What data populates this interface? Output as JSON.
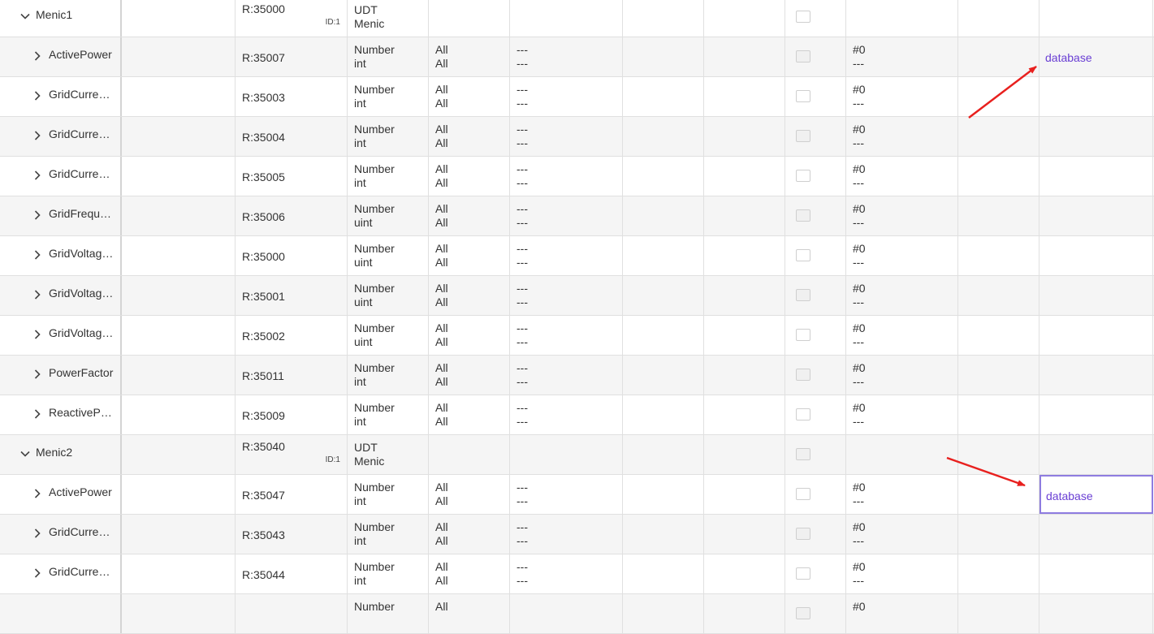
{
  "colors": {
    "link": "#6a3fd4",
    "annotation_arrow": "#e8201e",
    "selection_border": "#8e7ce0"
  },
  "icons": {
    "collapse": "chevron-down-icon",
    "expand": "chevron-right-icon"
  },
  "rows": [
    {
      "kind": "group",
      "expanded": true,
      "name": "Menic1",
      "address": "R:35000",
      "id_label": "ID:1",
      "type_line1": "UDT",
      "type_line2": "Menic",
      "col5_line1": "",
      "col5_line2": "",
      "col6_line1": "",
      "col6_line2": "",
      "col10_line1": "",
      "col10_line2": "",
      "link": ""
    },
    {
      "kind": "child",
      "expanded": false,
      "name": "ActivePower",
      "address": "R:35007",
      "id_label": "",
      "type_line1": "Number",
      "type_line2": "int",
      "col5_line1": "All",
      "col5_line2": "All",
      "col6_line1": "---",
      "col6_line2": "---",
      "col10_line1": "#0",
      "col10_line2": "---",
      "link": "database"
    },
    {
      "kind": "child",
      "expanded": false,
      "name": "GridCurrentA",
      "address": "R:35003",
      "id_label": "",
      "type_line1": "Number",
      "type_line2": "int",
      "col5_line1": "All",
      "col5_line2": "All",
      "col6_line1": "---",
      "col6_line2": "---",
      "col10_line1": "#0",
      "col10_line2": "---",
      "link": ""
    },
    {
      "kind": "child",
      "expanded": false,
      "name": "GridCurrentB",
      "address": "R:35004",
      "id_label": "",
      "type_line1": "Number",
      "type_line2": "int",
      "col5_line1": "All",
      "col5_line2": "All",
      "col6_line1": "---",
      "col6_line2": "---",
      "col10_line1": "#0",
      "col10_line2": "---",
      "link": ""
    },
    {
      "kind": "child",
      "expanded": false,
      "name": "GridCurrentC",
      "address": "R:35005",
      "id_label": "",
      "type_line1": "Number",
      "type_line2": "int",
      "col5_line1": "All",
      "col5_line2": "All",
      "col6_line1": "---",
      "col6_line2": "---",
      "col10_line1": "#0",
      "col10_line2": "---",
      "link": ""
    },
    {
      "kind": "child",
      "expanded": false,
      "name": "GridFreque…",
      "address": "R:35006",
      "id_label": "",
      "type_line1": "Number",
      "type_line2": "uint",
      "col5_line1": "All",
      "col5_line2": "All",
      "col6_line1": "---",
      "col6_line2": "---",
      "col10_line1": "#0",
      "col10_line2": "---",
      "link": ""
    },
    {
      "kind": "child",
      "expanded": false,
      "name": "GridVoltag…",
      "address": "R:35000",
      "id_label": "",
      "type_line1": "Number",
      "type_line2": "uint",
      "col5_line1": "All",
      "col5_line2": "All",
      "col6_line1": "---",
      "col6_line2": "---",
      "col10_line1": "#0",
      "col10_line2": "---",
      "link": ""
    },
    {
      "kind": "child",
      "expanded": false,
      "name": "GridVoltag…",
      "address": "R:35001",
      "id_label": "",
      "type_line1": "Number",
      "type_line2": "uint",
      "col5_line1": "All",
      "col5_line2": "All",
      "col6_line1": "---",
      "col6_line2": "---",
      "col10_line1": "#0",
      "col10_line2": "---",
      "link": ""
    },
    {
      "kind": "child",
      "expanded": false,
      "name": "GridVoltag…",
      "address": "R:35002",
      "id_label": "",
      "type_line1": "Number",
      "type_line2": "uint",
      "col5_line1": "All",
      "col5_line2": "All",
      "col6_line1": "---",
      "col6_line2": "---",
      "col10_line1": "#0",
      "col10_line2": "---",
      "link": ""
    },
    {
      "kind": "child",
      "expanded": false,
      "name": "PowerFactor",
      "address": "R:35011",
      "id_label": "",
      "type_line1": "Number",
      "type_line2": "int",
      "col5_line1": "All",
      "col5_line2": "All",
      "col6_line1": "---",
      "col6_line2": "---",
      "col10_line1": "#0",
      "col10_line2": "---",
      "link": ""
    },
    {
      "kind": "child",
      "expanded": false,
      "name": "ReactivePo…",
      "address": "R:35009",
      "id_label": "",
      "type_line1": "Number",
      "type_line2": "int",
      "col5_line1": "All",
      "col5_line2": "All",
      "col6_line1": "---",
      "col6_line2": "---",
      "col10_line1": "#0",
      "col10_line2": "---",
      "link": ""
    },
    {
      "kind": "group",
      "expanded": true,
      "name": "Menic2",
      "address": "R:35040",
      "id_label": "ID:1",
      "type_line1": "UDT",
      "type_line2": "Menic",
      "col5_line1": "",
      "col5_line2": "",
      "col6_line1": "",
      "col6_line2": "",
      "col10_line1": "",
      "col10_line2": "",
      "link": ""
    },
    {
      "kind": "child",
      "expanded": false,
      "name": "ActivePower",
      "address": "R:35047",
      "id_label": "",
      "type_line1": "Number",
      "type_line2": "int",
      "col5_line1": "All",
      "col5_line2": "All",
      "col6_line1": "---",
      "col6_line2": "---",
      "col10_line1": "#0",
      "col10_line2": "---",
      "link": "database",
      "selected": true
    },
    {
      "kind": "child",
      "expanded": false,
      "name": "GridCurrentA",
      "address": "R:35043",
      "id_label": "",
      "type_line1": "Number",
      "type_line2": "int",
      "col5_line1": "All",
      "col5_line2": "All",
      "col6_line1": "---",
      "col6_line2": "---",
      "col10_line1": "#0",
      "col10_line2": "---",
      "link": ""
    },
    {
      "kind": "child",
      "expanded": false,
      "name": "GridCurrentB",
      "address": "R:35044",
      "id_label": "",
      "type_line1": "Number",
      "type_line2": "int",
      "col5_line1": "All",
      "col5_line2": "All",
      "col6_line1": "---",
      "col6_line2": "---",
      "col10_line1": "#0",
      "col10_line2": "---",
      "link": ""
    },
    {
      "kind": "child",
      "expanded": false,
      "name": "",
      "address": "",
      "id_label": "",
      "type_line1": "Number",
      "type_line2": "",
      "col5_line1": "All",
      "col5_line2": "",
      "col6_line1": "",
      "col6_line2": "",
      "col10_line1": "#0",
      "col10_line2": "",
      "link": ""
    }
  ]
}
